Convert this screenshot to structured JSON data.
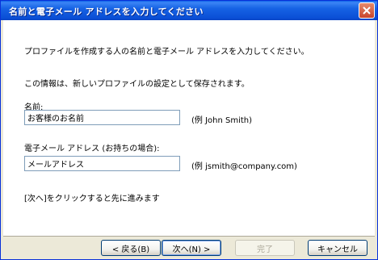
{
  "window": {
    "title": "名前と電子メール アドレスを入力してください"
  },
  "intro": "プロファイルを作成する人の名前と電子メール アドレスを入力してください。",
  "info": "この情報は、新しいプロファイルの設定として保存されます。",
  "name": {
    "label": "名前:",
    "value": "お客様のお名前",
    "example": "(例 John Smith)"
  },
  "email": {
    "label": "電子メール アドレス (お持ちの場合):",
    "value": "メールアドレス",
    "example": "(例 jsmith@company.com)"
  },
  "instruction": "[次へ]をクリックすると先に進みます",
  "buttons": {
    "back": "< 戻る(B)",
    "next": "次へ(N) >",
    "finish": "完了",
    "cancel": "キャンセル"
  },
  "colors": {
    "titlebar": "#0a5fe8",
    "close": "#c8452c",
    "dialog_bg": "#ece9d8"
  }
}
